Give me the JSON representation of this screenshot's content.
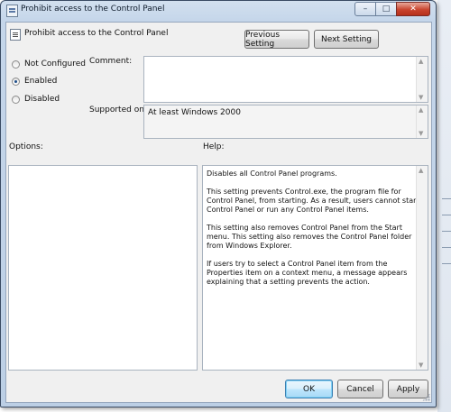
{
  "window": {
    "title": "Prohibit access to the Control Panel",
    "caption_buttons": {
      "minimize": "–",
      "maximize": "□",
      "close": "✕"
    }
  },
  "header": {
    "setting_name": "Prohibit access to the Control Panel",
    "icon": "policy-document-icon",
    "prev_label": "Previous Setting",
    "next_label": "Next Setting"
  },
  "state": {
    "options": [
      {
        "label": "Not Configured",
        "checked": false
      },
      {
        "label": "Enabled",
        "checked": true
      },
      {
        "label": "Disabled",
        "checked": false
      }
    ]
  },
  "comment": {
    "label": "Comment:",
    "value": ""
  },
  "supported": {
    "label": "Supported on:",
    "value": "At least Windows 2000"
  },
  "options_pane": {
    "label": "Options:"
  },
  "help_pane": {
    "label": "Help:",
    "paragraphs": [
      "Disables all Control Panel programs.",
      "This setting prevents Control.exe, the program file for Control Panel, from starting. As a result, users cannot start Control Panel or run any Control Panel items.",
      "This setting also removes Control Panel from the Start menu. This setting also removes the Control Panel folder from Windows Explorer.",
      "If users try to select a Control Panel item from the Properties item on a context menu, a message appears explaining that a setting prevents the action."
    ]
  },
  "footer": {
    "ok_label": "OK",
    "cancel_label": "Cancel",
    "apply_label": "Apply"
  },
  "colors": {
    "title_bar": "#c5d6ea",
    "client": "#f0f0f0",
    "close_button": "#c9442e",
    "default_button": "#3c7fb1"
  }
}
